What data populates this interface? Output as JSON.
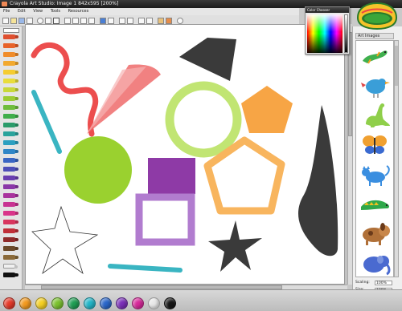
{
  "window": {
    "title": "Crayola Art Studio: Image 1   842x595 [200%]"
  },
  "menu": {
    "items": [
      "File",
      "Edit",
      "View",
      "Tools",
      "Resources"
    ]
  },
  "color_chooser": {
    "title": "Color Chooser"
  },
  "art_panel": {
    "header": "Art Images",
    "items": [
      "lizard",
      "bird",
      "dinosaur",
      "butterfly",
      "cat",
      "lizard-2",
      "dog",
      "elephant"
    ]
  },
  "properties": {
    "scaling_label": "Scaling:",
    "scaling_value": "100%",
    "size_label": "Size:",
    "size_value": "100%"
  },
  "palette": {
    "colors": [
      "#e53a2a",
      "#f39a1f",
      "#f5d021",
      "#7bc22f",
      "#1f9e53",
      "#21b5c8",
      "#2a66c9",
      "#7a2fb8",
      "#d7289a",
      "#e8e8e8",
      "#151515"
    ]
  },
  "crayons": {
    "colors": [
      "#e05030",
      "#e8632a",
      "#f08c2a",
      "#f2a92e",
      "#f5cc30",
      "#e9dd3a",
      "#c9d83a",
      "#9ccc34",
      "#6fbd3d",
      "#3fae4b",
      "#2a9b6a",
      "#29a39c",
      "#2c9fc0",
      "#2f86c7",
      "#3a66c3",
      "#4e4fb8",
      "#6a3fb0",
      "#8a37a8",
      "#a9339d",
      "#c83392",
      "#d9348a",
      "#d8365e",
      "#c02e38",
      "#8f2a2a",
      "#6a4a2a",
      "#8a6a3a",
      "#f0f0f0",
      "#111111"
    ]
  },
  "canvas": {
    "shapes": [
      "red-scribble",
      "red-fan",
      "black-triangle",
      "cyan-stroke",
      "green-ring",
      "orange-pentagon",
      "green-circle",
      "purple-square",
      "orange-pentagon-outline",
      "black-wedge",
      "purple-square-outline",
      "white-star",
      "dark-star",
      "cyan-line"
    ]
  }
}
